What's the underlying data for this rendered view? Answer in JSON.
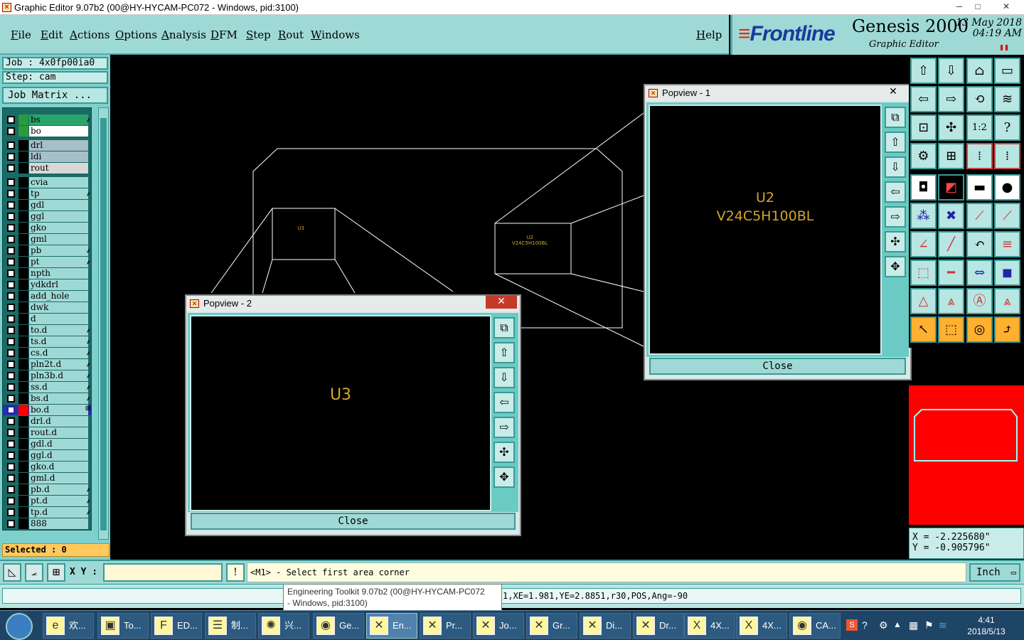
{
  "window": {
    "title": "Graphic Editor 9.07b2 (00@HY-HYCAM-PC072 - Windows, pid:3100)",
    "controls": [
      "─",
      "□",
      "✕"
    ]
  },
  "menu": {
    "items": [
      "File",
      "Edit",
      "Actions",
      "Options",
      "Analysis",
      "DFM",
      "Step",
      "Rout",
      "Windows"
    ],
    "help": "Help"
  },
  "brand": {
    "logo": "Frontline",
    "product": "Genesis 2000",
    "subtitle": "Graphic Editor",
    "date": "13 May 2018",
    "time": "04:19 AM"
  },
  "job": {
    "job_label": "Job : 4x0fp00ia0",
    "step_label": "Step: cam",
    "matrix_button": "Job Matrix ..."
  },
  "layers": [
    {
      "name": "bs",
      "color": "#2a9a3a",
      "mark": "⸙"
    },
    {
      "name": "bo",
      "color": "#2a9a3a",
      "mark": ""
    },
    {
      "name": "drl",
      "color": "#000000",
      "mark": ""
    },
    {
      "name": "ldi",
      "color": "#000000",
      "mark": ""
    },
    {
      "name": "rout",
      "color": "#000000",
      "mark": ""
    },
    {
      "name": "cvia",
      "color": "#000000",
      "mark": ""
    },
    {
      "name": "tp",
      "color": "#000000",
      "mark": "⸙"
    },
    {
      "name": "gdl",
      "color": "#000000",
      "mark": ""
    },
    {
      "name": "ggl",
      "color": "#000000",
      "mark": ""
    },
    {
      "name": "gko",
      "color": "#000000",
      "mark": ""
    },
    {
      "name": "gml",
      "color": "#000000",
      "mark": ""
    },
    {
      "name": "pb",
      "color": "#000000",
      "mark": "⸙"
    },
    {
      "name": "pt",
      "color": "#000000",
      "mark": "⸙"
    },
    {
      "name": "npth",
      "color": "#000000",
      "mark": ""
    },
    {
      "name": "ydkdrl",
      "color": "#000000",
      "mark": ""
    },
    {
      "name": "add_hole",
      "color": "#000000",
      "mark": ""
    },
    {
      "name": "dwk",
      "color": "#000000",
      "mark": ""
    },
    {
      "name": "d",
      "color": "#000000",
      "mark": ""
    },
    {
      "name": "to.d",
      "color": "#000000",
      "mark": "⸙"
    },
    {
      "name": "ts.d",
      "color": "#000000",
      "mark": "⸙"
    },
    {
      "name": "cs.d",
      "color": "#000000",
      "mark": "⸙"
    },
    {
      "name": "pln2t.d",
      "color": "#000000",
      "mark": "⸙"
    },
    {
      "name": "pln3b.d",
      "color": "#000000",
      "mark": "⸙"
    },
    {
      "name": "ss.d",
      "color": "#000000",
      "mark": "⸙"
    },
    {
      "name": "bs.d",
      "color": "#000000",
      "mark": "⸙"
    },
    {
      "name": "bo.d",
      "color": "#ff0000",
      "mark": "⊞"
    },
    {
      "name": "drl.d",
      "color": "#000000",
      "mark": ""
    },
    {
      "name": "rout.d",
      "color": "#000000",
      "mark": ""
    },
    {
      "name": "gdl.d",
      "color": "#000000",
      "mark": ""
    },
    {
      "name": "ggl.d",
      "color": "#000000",
      "mark": ""
    },
    {
      "name": "gko.d",
      "color": "#000000",
      "mark": ""
    },
    {
      "name": "gml.d",
      "color": "#000000",
      "mark": ""
    },
    {
      "name": "pb.d",
      "color": "#000000",
      "mark": "⸙"
    },
    {
      "name": "pt.d",
      "color": "#000000",
      "mark": "⸙"
    },
    {
      "name": "tp.d",
      "color": "#000000",
      "mark": "⸙"
    },
    {
      "name": "888",
      "color": "#000000",
      "mark": ""
    }
  ],
  "selected": "Selected : 0",
  "canvas": {
    "u3_small": "U3",
    "u2_small_line1": "U2",
    "u2_small_line2": "V24C5H100BL",
    "line_color": "#ffffff"
  },
  "popview1": {
    "title": "Popview - 1",
    "close": "Close",
    "text_line1": "U2",
    "text_line2": "V24C5H100BL"
  },
  "popview2": {
    "title": "Popview - 2",
    "close": "Close",
    "text": "U3"
  },
  "coords": {
    "x": "X = -2.225680\"",
    "y": "Y = -0.905796\""
  },
  "command": {
    "xy_label": "X Y :",
    "xy_value": "",
    "prompt": "<M1> - Select first area corner",
    "units": "Inch",
    "bang": "!"
  },
  "history": {
    "text": "1,XE=1.981,YE=2.8851,r30,POS,Ang=-90"
  },
  "tooltip": {
    "line1": "Engineering Toolkit 9.07b2 (00@HY-HYCAM-PC072",
    "line2": "- Windows, pid:3100)"
  },
  "taskbar": {
    "items": [
      {
        "label": "欢...",
        "icon": "e"
      },
      {
        "label": "To...",
        "icon": "▣"
      },
      {
        "label": "ED...",
        "icon": "F"
      },
      {
        "label": "制...",
        "icon": "☰"
      },
      {
        "label": "兴...",
        "icon": "✺"
      },
      {
        "label": "Ge...",
        "icon": "◉"
      },
      {
        "label": "En...",
        "icon": "✕"
      },
      {
        "label": "Pr...",
        "icon": "✕"
      },
      {
        "label": "Jo...",
        "icon": "✕"
      },
      {
        "label": "Gr...",
        "icon": "✕"
      },
      {
        "label": "Di...",
        "icon": "✕"
      },
      {
        "label": "Dr...",
        "icon": "✕"
      },
      {
        "label": "4X...",
        "icon": "X"
      },
      {
        "label": "4X...",
        "icon": "X"
      },
      {
        "label": "CA...",
        "icon": "◉"
      }
    ],
    "clock_time": "4:41",
    "clock_date": "2018/5/13"
  }
}
